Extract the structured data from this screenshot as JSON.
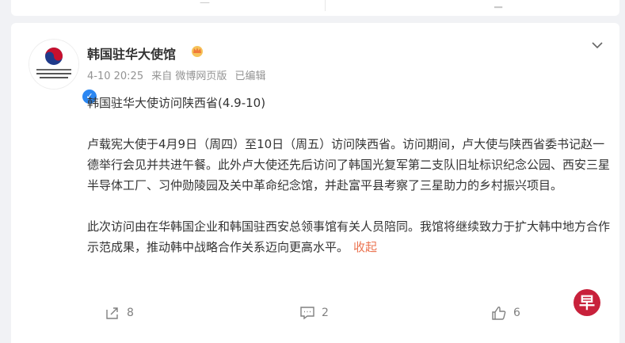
{
  "post": {
    "author": "韩国驻华大使馆",
    "avatar_text_line1": "주중국대한민국대사관",
    "avatar_text_line2": "大韩民国驻华大使馆",
    "meta": {
      "date": "4-10 20:25",
      "source": "来自 微博网页版",
      "edited": "已编辑"
    },
    "title_line": "韩国驻华大使访问陕西省(4.9-10)",
    "paragraphs": [
      "卢载宪大使于4月9日（周四）至10日（周五）访问陕西省。访问期间，卢大使与陕西省委书记赵一德举行会见并共进午餐。此外卢大使还先后访问了韩国光复军第二支队旧址标识纪念公园、西安三星半导体工厂、习仲勋陵园及关中革命纪念馆，并赴富平县考察了三星助力的乡村振兴项目。",
      "此次访问由在华韩国企业和韩国驻西安总领事馆有关人员陪同。我馆将继续致力于扩大韩中地方合作示范成果，推动韩中战略合作关系迈向更高水平。"
    ],
    "collapse_label": "收起",
    "actions": {
      "forward_count": "8",
      "comment_count": "2",
      "like_count": "6"
    }
  },
  "badge_char": "早",
  "colors": {
    "accent": "#eb7350",
    "verified": "#2b87f2",
    "badge": "#c8213b"
  }
}
